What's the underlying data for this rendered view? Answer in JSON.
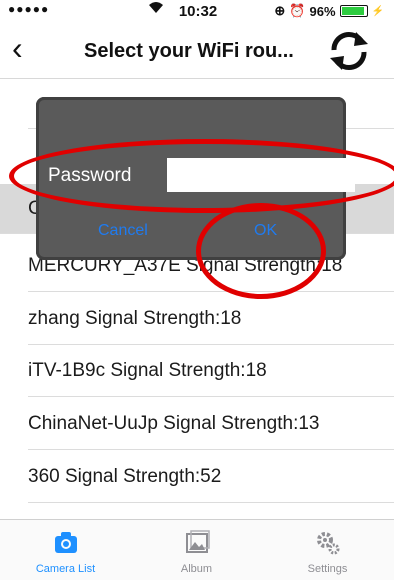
{
  "status_bar": {
    "signal": "●●●●●",
    "time": "10:32",
    "battery_percent": "96%",
    "battery_level": 0.96
  },
  "nav": {
    "back_glyph": "‹",
    "title": "Select your WiFi rou...",
    "refresh_icon": "refresh-icon"
  },
  "list": {
    "rows": [
      "",
      "C",
      "MERCURY_A37E Signal Strength:18",
      "zhang Signal Strength:18",
      "iTV-1B9c Signal Strength:18",
      "ChinaNet-UuJp Signal Strength:13",
      "360 Signal Strength:52"
    ]
  },
  "dialog": {
    "password_label": "Password",
    "password_value": "",
    "cancel_label": "Cancel",
    "ok_label": "OK"
  },
  "tabbar": {
    "tabs": [
      {
        "label": "Camera List",
        "icon": "camera-icon",
        "active": true
      },
      {
        "label": "Album",
        "icon": "album-icon",
        "active": false
      },
      {
        "label": "Settings",
        "icon": "gear-icon",
        "active": false
      }
    ]
  },
  "colors": {
    "accent": "#1e90ff",
    "dialog_bg": "#5a5a5a",
    "annotation": "#e00000"
  }
}
